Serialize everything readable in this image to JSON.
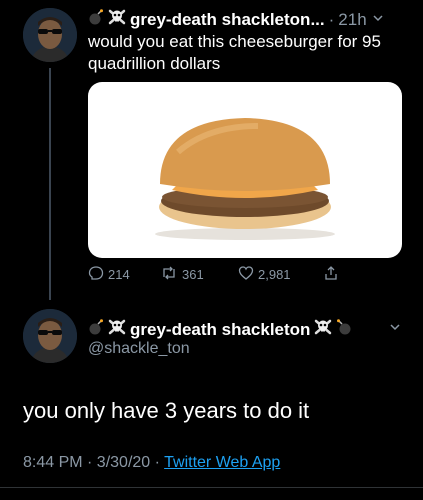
{
  "tweet1": {
    "display_name": "grey-death shackleton...",
    "time": "21h",
    "text": "would you eat this cheeseburger for 95 quadrillion dollars",
    "reply_count": "214",
    "retweet_count": "361",
    "like_count": "2,981"
  },
  "tweet2": {
    "display_name": "grey-death shackleton",
    "handle": "@shackle_ton",
    "text": "you only have 3 years to do it",
    "timestamp": "8:44 PM · 3/30/20 ·",
    "source": "Twitter Web App"
  },
  "separators": {
    "dot": "·"
  },
  "icons": [
    "bomb-icon",
    "skull-crossbones-icon",
    "chevron-down-icon",
    "reply-icon",
    "retweet-icon",
    "like-icon",
    "share-icon"
  ],
  "colors": {
    "background": "#000000",
    "muted": "#8b98a5",
    "link": "#1da1f2"
  }
}
